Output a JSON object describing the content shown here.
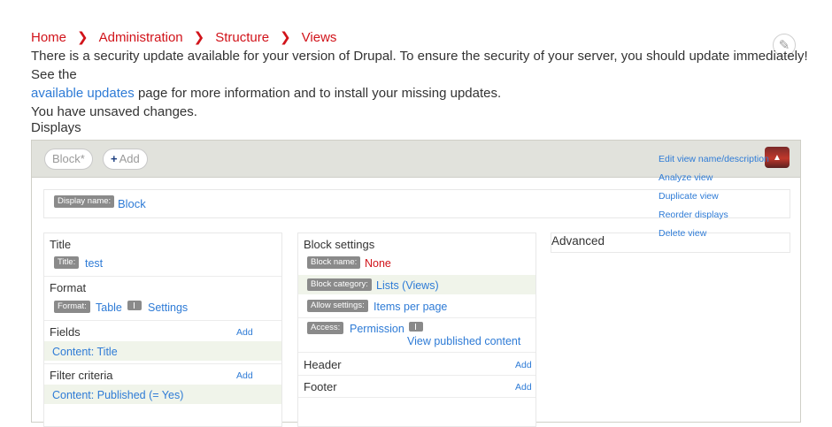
{
  "breadcrumb": {
    "items": [
      "Home",
      "Administration",
      "Structure",
      "Views"
    ]
  },
  "messages": {
    "security_prefix": "There is a security update available for your version of Drupal. To ensure the security of your server, you should update immediately! See the",
    "security_link": "available updates",
    "security_suffix": "page for more information and to install your missing updates.",
    "unsaved": "You have unsaved changes."
  },
  "displays": {
    "heading": "Displays",
    "tabs": {
      "block": "Block*",
      "add": "Add"
    },
    "menu": {
      "edit_name": "Edit view name/description",
      "analyze": "Analyze view",
      "duplicate": "Duplicate view",
      "reorder": "Reorder displays",
      "delete": "Delete view"
    },
    "display_name": {
      "label": "Display name:",
      "value": "Block"
    }
  },
  "column1": {
    "title": {
      "heading": "Title",
      "label": "Title:",
      "value": "test"
    },
    "format": {
      "heading": "Format",
      "label": "Format:",
      "value": "Table",
      "settings": "Settings"
    },
    "fields": {
      "heading": "Fields",
      "add": "Add",
      "item": "Content: Title"
    },
    "filter": {
      "heading": "Filter criteria",
      "add": "Add",
      "item": "Content: Published (= Yes)"
    }
  },
  "column2": {
    "heading": "Block settings",
    "block_name": {
      "label": "Block name:",
      "value": "None"
    },
    "block_category": {
      "label": "Block category:",
      "value": "Lists (Views)"
    },
    "allow_settings": {
      "label": "Allow settings:",
      "value": "Items per page"
    },
    "access": {
      "label": "Access:",
      "value": "Permission",
      "extra": "View published content"
    },
    "header": {
      "heading": "Header",
      "add": "Add"
    },
    "footer": {
      "heading": "Footer",
      "add": "Add"
    }
  },
  "column3": {
    "heading": "Advanced"
  },
  "colors": {
    "breadcrumb": "#d1131a",
    "link": "#2e7bd6",
    "tabbar": "#e1e2dc",
    "highlight_row": "#f0f4ea",
    "badge": "#8a8a8a"
  }
}
